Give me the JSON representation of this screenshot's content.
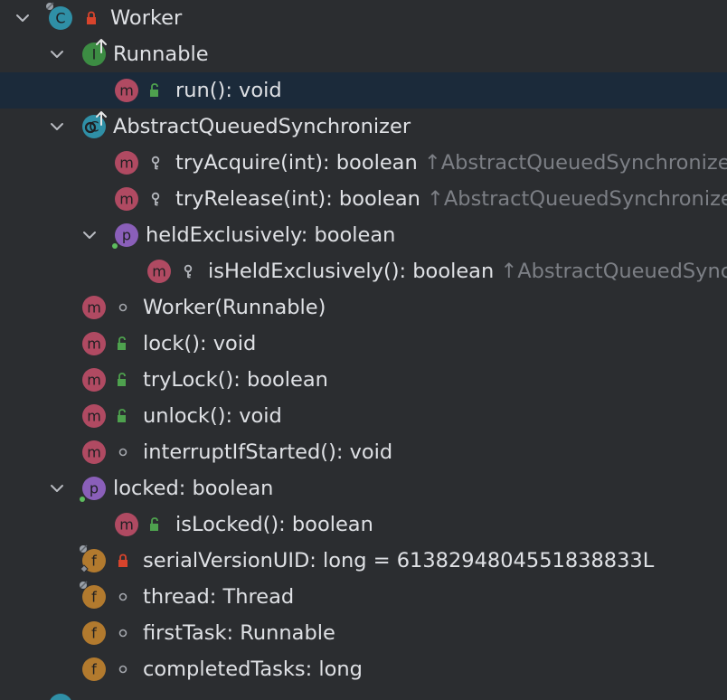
{
  "tree": {
    "rows": [
      {
        "depth": 0,
        "expander": "expanded",
        "kind": "class",
        "icon": "class-icon",
        "badge_letter": "C",
        "badge_color": "#2f8fa6",
        "visibility": "private",
        "label": "Worker",
        "suffix": "",
        "overlays": [
          "pin"
        ]
      },
      {
        "depth": 1,
        "expander": "expanded",
        "kind": "interface",
        "icon": "interface-icon",
        "badge_letter": "I",
        "badge_color": "#3c8c43",
        "visibility": "none",
        "label": "Runnable",
        "suffix": "",
        "overlays": [
          "implements-arrow"
        ]
      },
      {
        "depth": 2,
        "expander": "none",
        "kind": "method",
        "icon": "method-icon",
        "badge_letter": "m",
        "badge_color": "#b04a62",
        "visibility": "public",
        "label": "run(): void",
        "suffix": "",
        "selected": true,
        "overlays": []
      },
      {
        "depth": 1,
        "expander": "expanded",
        "kind": "abstract-class",
        "icon": "abstract-class-icon",
        "badge_letter": "C",
        "badge_color": "#2f8fa6",
        "visibility": "none",
        "label": "AbstractQueuedSynchronizer",
        "suffix": "",
        "overlays": [
          "extends-arrow"
        ]
      },
      {
        "depth": 2,
        "expander": "none",
        "kind": "method",
        "icon": "method-icon",
        "badge_letter": "m",
        "badge_color": "#b04a62",
        "visibility": "protected",
        "label": "tryAcquire(int): boolean",
        "suffix": "↑AbstractQueuedSynchronizer",
        "overlays": []
      },
      {
        "depth": 2,
        "expander": "none",
        "kind": "method",
        "icon": "method-icon",
        "badge_letter": "m",
        "badge_color": "#b04a62",
        "visibility": "protected",
        "label": "tryRelease(int): boolean",
        "suffix": "↑AbstractQueuedSynchronizer",
        "overlays": []
      },
      {
        "depth": 2,
        "expander": "expanded",
        "kind": "property",
        "icon": "property-icon",
        "badge_letter": "p",
        "badge_color": "#8a5fb9",
        "visibility": "none",
        "label": "heldExclusively: boolean",
        "suffix": "",
        "overlays": [
          "green-dot"
        ]
      },
      {
        "depth": 3,
        "expander": "none",
        "kind": "method",
        "icon": "method-icon",
        "badge_letter": "m",
        "badge_color": "#b04a62",
        "visibility": "protected",
        "label": "isHeldExclusively(): boolean",
        "suffix": "↑AbstractQueuedSynchronizer",
        "overlays": []
      },
      {
        "depth": 1,
        "expander": "none",
        "kind": "method",
        "icon": "method-icon",
        "badge_letter": "m",
        "badge_color": "#b04a62",
        "visibility": "package",
        "label": "Worker(Runnable)",
        "suffix": "",
        "overlays": []
      },
      {
        "depth": 1,
        "expander": "none",
        "kind": "method",
        "icon": "method-icon",
        "badge_letter": "m",
        "badge_color": "#b04a62",
        "visibility": "public",
        "label": "lock(): void",
        "suffix": "",
        "overlays": []
      },
      {
        "depth": 1,
        "expander": "none",
        "kind": "method",
        "icon": "method-icon",
        "badge_letter": "m",
        "badge_color": "#b04a62",
        "visibility": "public",
        "label": "tryLock(): boolean",
        "suffix": "",
        "overlays": []
      },
      {
        "depth": 1,
        "expander": "none",
        "kind": "method",
        "icon": "method-icon",
        "badge_letter": "m",
        "badge_color": "#b04a62",
        "visibility": "public",
        "label": "unlock(): void",
        "suffix": "",
        "overlays": []
      },
      {
        "depth": 1,
        "expander": "none",
        "kind": "method",
        "icon": "method-icon",
        "badge_letter": "m",
        "badge_color": "#b04a62",
        "visibility": "package",
        "label": "interruptIfStarted(): void",
        "suffix": "",
        "overlays": []
      },
      {
        "depth": 1,
        "expander": "expanded",
        "kind": "property",
        "icon": "property-icon",
        "badge_letter": "p",
        "badge_color": "#8a5fb9",
        "visibility": "none",
        "label": "locked: boolean",
        "suffix": "",
        "overlays": [
          "green-dot"
        ]
      },
      {
        "depth": 2,
        "expander": "none",
        "kind": "method",
        "icon": "method-icon",
        "badge_letter": "m",
        "badge_color": "#b04a62",
        "visibility": "public",
        "label": "isLocked(): boolean",
        "suffix": "",
        "overlays": []
      },
      {
        "depth": 1,
        "expander": "none",
        "kind": "field",
        "icon": "field-icon",
        "badge_letter": "f",
        "badge_color": "#b27a2e",
        "visibility": "private",
        "label": "serialVersionUID: long = 6138294804551838833L",
        "suffix": "",
        "overlays": [
          "pin",
          "static-diamond"
        ]
      },
      {
        "depth": 1,
        "expander": "none",
        "kind": "field",
        "icon": "field-icon",
        "badge_letter": "f",
        "badge_color": "#b27a2e",
        "visibility": "package",
        "label": "thread: Thread",
        "suffix": "",
        "overlays": [
          "pin"
        ]
      },
      {
        "depth": 1,
        "expander": "none",
        "kind": "field",
        "icon": "field-icon",
        "badge_letter": "f",
        "badge_color": "#b27a2e",
        "visibility": "package",
        "label": "firstTask: Runnable",
        "suffix": "",
        "overlays": []
      },
      {
        "depth": 1,
        "expander": "none",
        "kind": "field",
        "icon": "field-icon",
        "badge_letter": "f",
        "badge_color": "#b27a2e",
        "visibility": "package",
        "label": "completedTasks: long",
        "suffix": "",
        "overlays": []
      },
      {
        "depth": 0,
        "expander": "none",
        "kind": "class",
        "icon": "class-icon",
        "badge_letter": "",
        "badge_color": "#2f8fa6",
        "visibility": "none",
        "label": "",
        "suffix": "",
        "partial": true,
        "overlays": []
      }
    ]
  },
  "colors": {
    "background": "#2b2d30",
    "selection": "#1b2a3a",
    "text": "#dfe1e5",
    "suffix_text": "#7c7f85",
    "chevron": "#b9bcc2",
    "visibility_public": "#4ea14e",
    "visibility_private": "#d8442c",
    "visibility_protected": "#b3b6bc",
    "visibility_package": "#a3a6ac"
  }
}
